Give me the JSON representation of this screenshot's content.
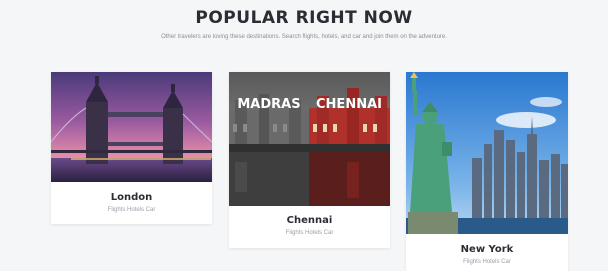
{
  "section": {
    "title": "POPULAR RIGHT NOW",
    "subtitle": "Other travelers are loving these destinations. Search flights, hotels, and car and join them on the adventure."
  },
  "destinations": [
    {
      "name": "London",
      "services": "Flights Hotels Car",
      "photo_icon": "tower-bridge-photo"
    },
    {
      "name": "Chennai",
      "services": "Flights Hotels Car",
      "photo_icon": "madras-chennai-photo",
      "photo_caption_left": "MADRAS",
      "photo_caption_right": "CHENNAI"
    },
    {
      "name": "New York",
      "services": "Flights Hotels Car",
      "photo_icon": "statue-of-liberty-photo"
    }
  ],
  "colors": {
    "background": "#f5f6f8",
    "title": "#2a2d33",
    "subtitle": "#8a8f98",
    "card": "#ffffff"
  }
}
